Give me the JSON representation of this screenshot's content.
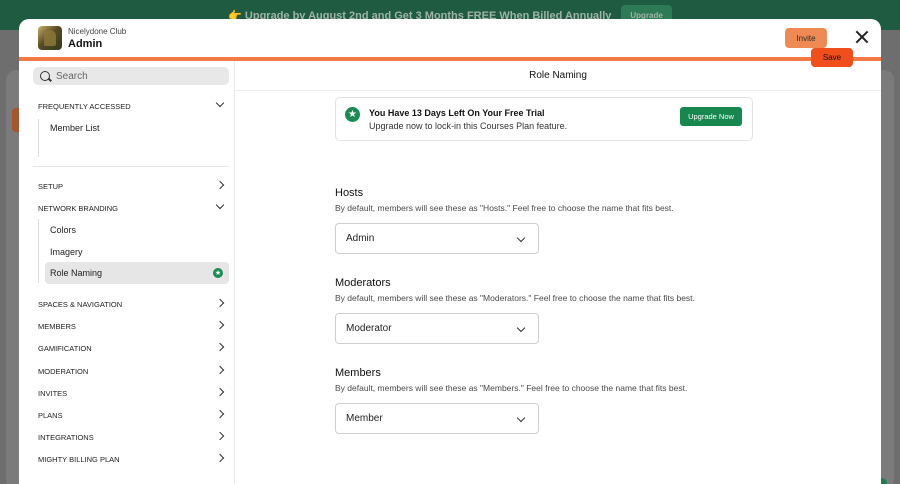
{
  "promo": {
    "text": "👉 Upgrade by August 2nd and Get 3 Months FREE When Billed Annually",
    "button": "Upgrade"
  },
  "header": {
    "club_name": "Nicelydone Club",
    "role": "Admin",
    "invite_label": "Invite"
  },
  "sidebar": {
    "search_placeholder": "Search",
    "frequently_accessed": {
      "label": "FREQUENTLY ACCESSED",
      "items": [
        "Member List"
      ]
    },
    "setup": "SETUP",
    "network_branding": {
      "label": "NETWORK BRANDING",
      "items": [
        "Colors",
        "Imagery",
        "Role Naming"
      ]
    },
    "sections": [
      "SPACES & NAVIGATION",
      "MEMBERS",
      "GAMIFICATION",
      "MODERATION",
      "INVITES",
      "PLANS",
      "INTEGRATIONS",
      "MIGHTY BILLING PLAN"
    ],
    "active_item": "Role Naming"
  },
  "content": {
    "title": "Role Naming",
    "save_label": "Save",
    "trial": {
      "title": "You Have 13 Days Left On Your Free Trial",
      "subtitle": "Upgrade now to lock-in this Courses Plan feature.",
      "button": "Upgrade Now"
    },
    "roles": [
      {
        "title": "Hosts",
        "description": "By default, members will see these as \"Hosts.\" Feel free to choose the name that fits best.",
        "value": "Admin"
      },
      {
        "title": "Moderators",
        "description": "By default, members will see these as \"Moderators.\" Feel free to choose the name that fits best.",
        "value": "Moderator"
      },
      {
        "title": "Members",
        "description": "By default, members will see these as \"Members.\" Feel free to choose the name that fits best.",
        "value": "Member"
      }
    ]
  },
  "colors": {
    "brand_green": "#17874f",
    "accent_orange": "#f47a43",
    "save_red": "#f04e1a"
  }
}
